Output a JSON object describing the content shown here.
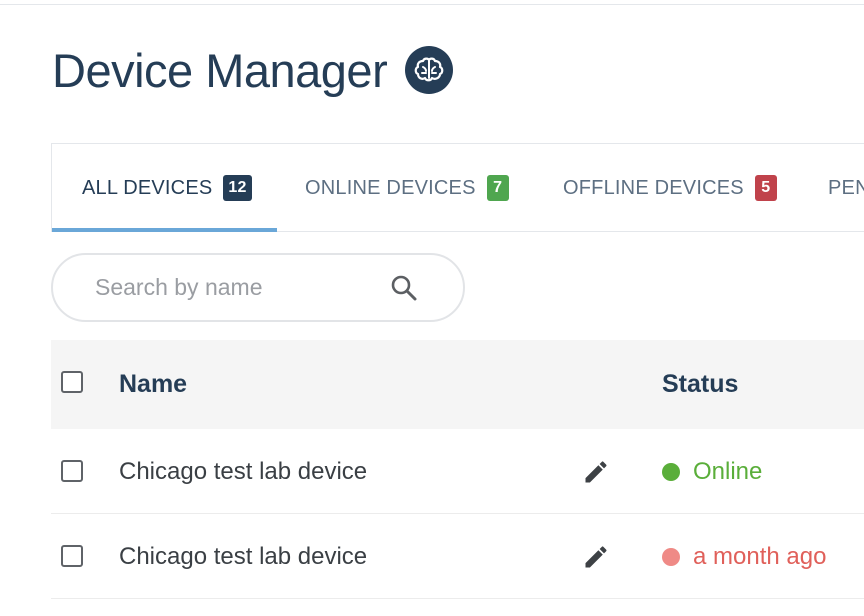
{
  "page": {
    "title": "Device Manager",
    "title_icon": "brain-icon"
  },
  "tabs": [
    {
      "label": "ALL DEVICES",
      "count": "12",
      "badge_color": "#253d56",
      "active": true
    },
    {
      "label": "ONLINE DEVICES",
      "count": "7",
      "badge_color": "#4fa64f",
      "active": false
    },
    {
      "label": "OFFLINE DEVICES",
      "count": "5",
      "badge_color": "#c0424b",
      "active": false
    },
    {
      "label": "PEN",
      "count": "",
      "badge_color": "",
      "active": false
    }
  ],
  "search": {
    "placeholder": "Search by name",
    "value": "",
    "icon": "search-icon"
  },
  "table": {
    "columns": {
      "name": "Name",
      "status": "Status"
    },
    "rows": [
      {
        "name": "Chicago test lab device",
        "status": "Online",
        "status_color": "#5aae3a",
        "dot_color": "#5aae3a",
        "edit_icon": "pencil-icon"
      },
      {
        "name": "Chicago test lab device",
        "status": "a month ago",
        "status_color": "#e0605a",
        "dot_color": "#ef8a86",
        "edit_icon": "pencil-icon"
      }
    ]
  },
  "colors": {
    "primary": "#253d56",
    "tab_indicator": "#6aa7d8"
  }
}
